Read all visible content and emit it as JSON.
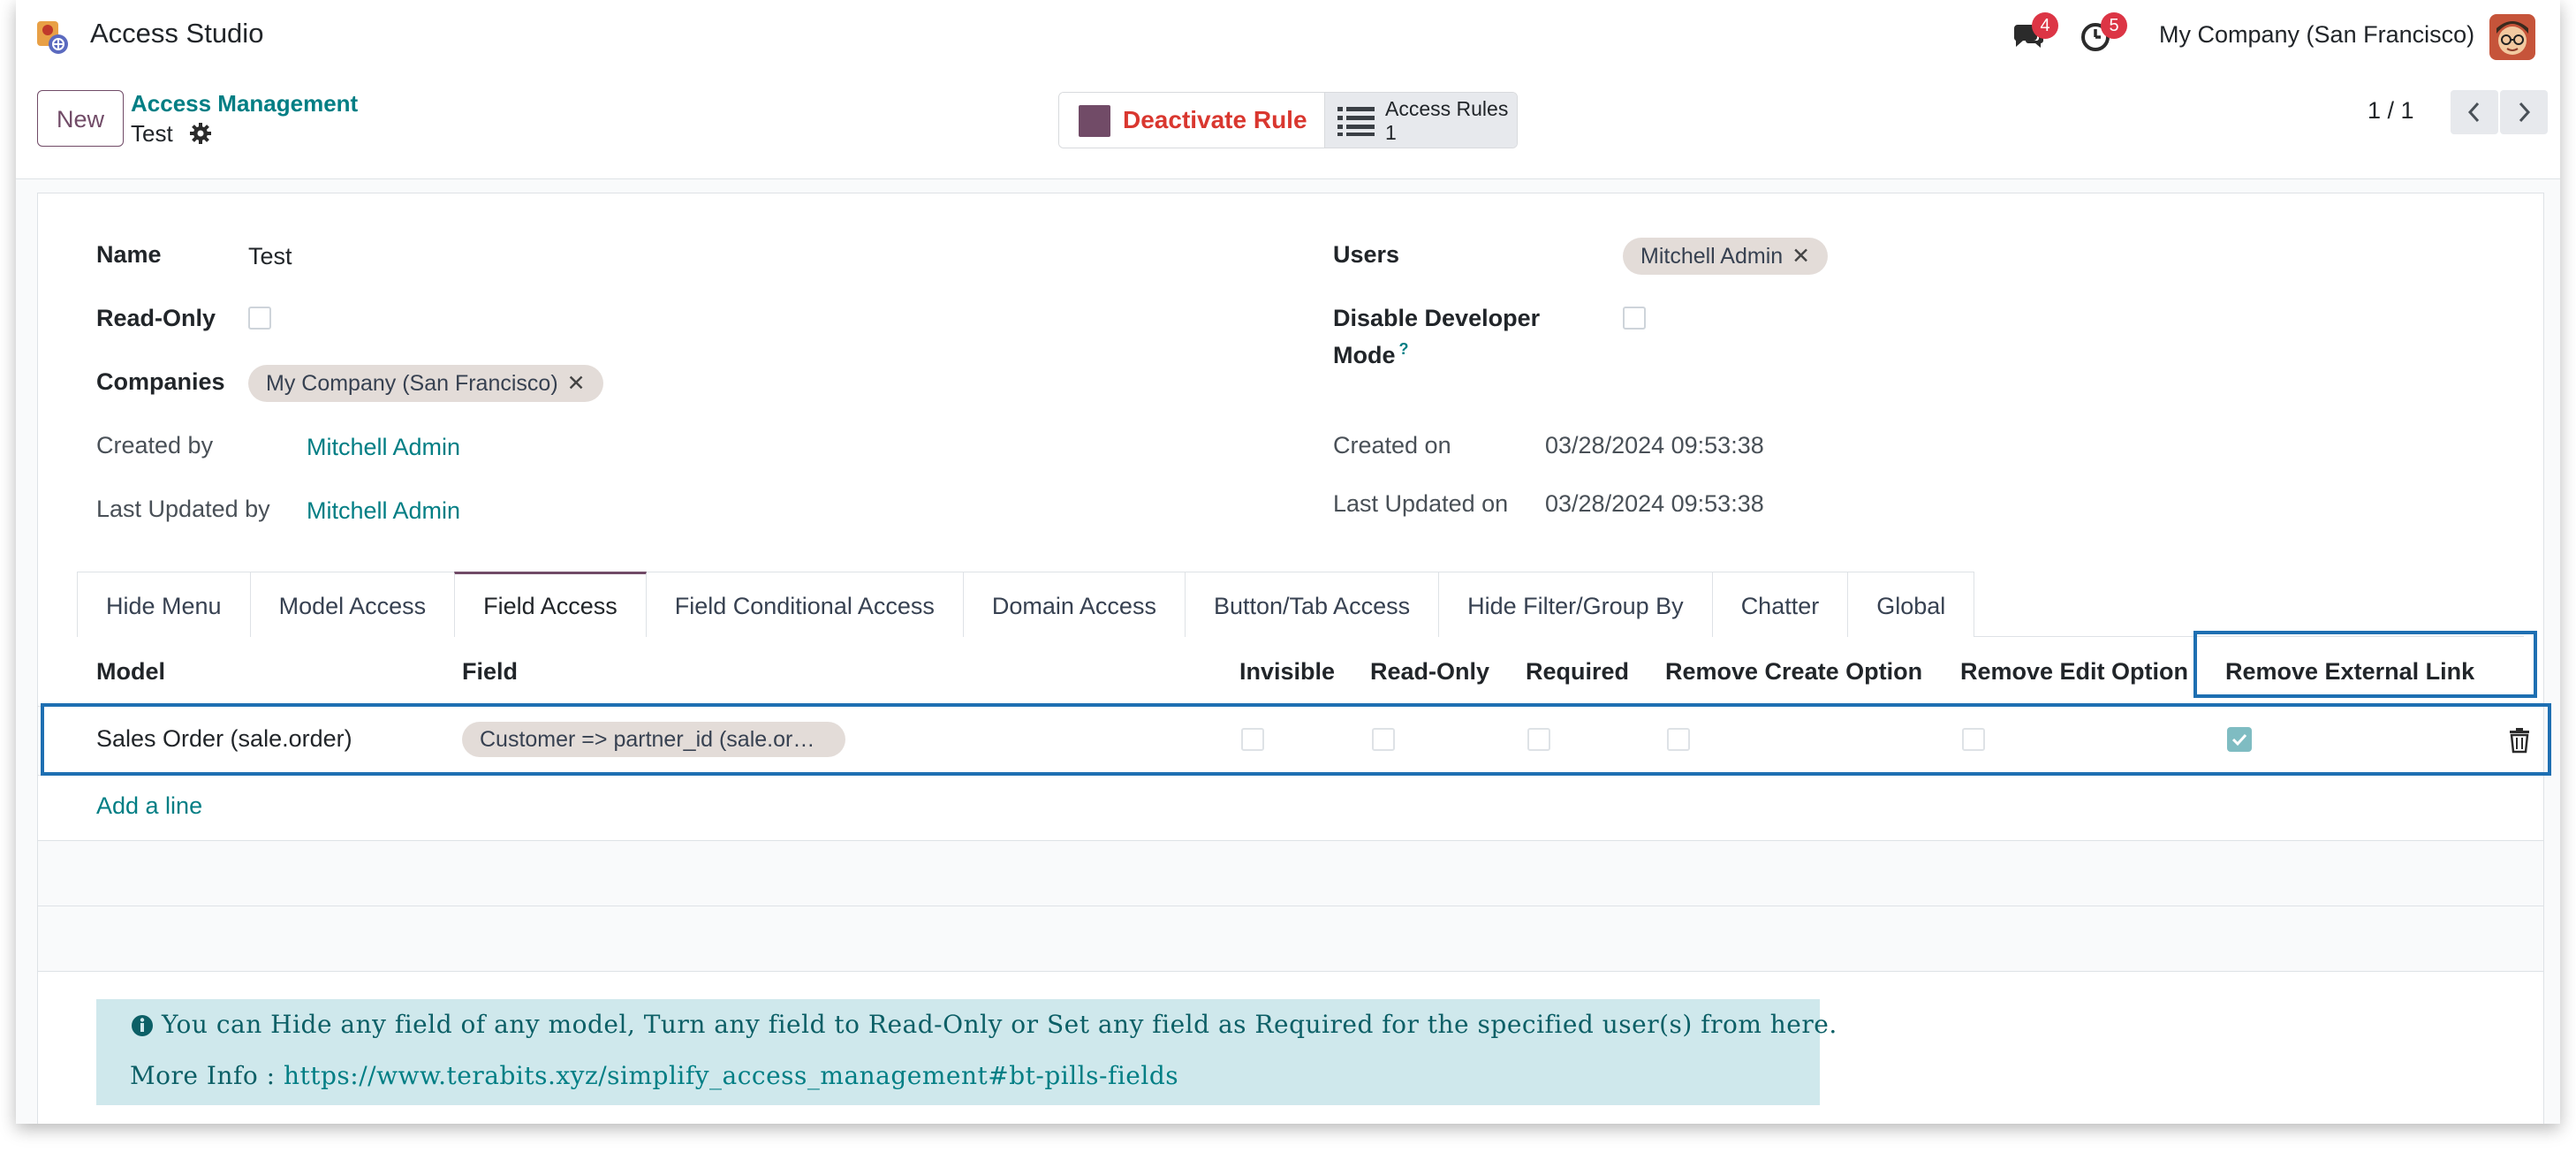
{
  "navbar": {
    "app_title": "Access Studio",
    "messages_badge": "4",
    "activity_badge": "5",
    "company": "My Company (San Francisco)"
  },
  "control_panel": {
    "new_label": "New",
    "breadcrumb_parent": "Access Management",
    "breadcrumb_current": "Test",
    "deactivate_label": "Deactivate Rule",
    "access_rules_label": "Access Rules",
    "access_rules_count": "1",
    "pager": "1 / 1"
  },
  "form": {
    "name_label": "Name",
    "name_value": "Test",
    "readonly_label": "Read-Only",
    "companies_label": "Companies",
    "company_tag": "My Company (San Francisco)",
    "created_by_label": "Created by",
    "created_by_value": "Mitchell Admin",
    "last_updated_by_label": "Last Updated by",
    "last_updated_by_value": "Mitchell Admin",
    "users_label": "Users",
    "user_tag": "Mitchell Admin",
    "disable_dev_label_1": "Disable Developer",
    "disable_dev_label_2": "Mode",
    "help_mark": "?",
    "created_on_label": "Created on",
    "created_on_value": "03/28/2024 09:53:38",
    "last_updated_on_label": "Last Updated on",
    "last_updated_on_value": "03/28/2024 09:53:38"
  },
  "tabs": [
    {
      "label": "Hide Menu",
      "active": false
    },
    {
      "label": "Model Access",
      "active": false
    },
    {
      "label": "Field Access",
      "active": true
    },
    {
      "label": "Field Conditional Access",
      "active": false
    },
    {
      "label": "Domain Access",
      "active": false
    },
    {
      "label": "Button/Tab Access",
      "active": false
    },
    {
      "label": "Hide Filter/Group By",
      "active": false
    },
    {
      "label": "Chatter",
      "active": false
    },
    {
      "label": "Global",
      "active": false
    }
  ],
  "table": {
    "headers": {
      "model": "Model",
      "field": "Field",
      "invisible": "Invisible",
      "readonly": "Read-Only",
      "required": "Required",
      "remove_create": "Remove Create Option",
      "remove_edit": "Remove Edit Option",
      "remove_external": "Remove External Link"
    },
    "rows": [
      {
        "model": "Sales Order (sale.order)",
        "field": "Customer => partner_id (sale.or…",
        "invisible": false,
        "readonly": false,
        "required": false,
        "remove_create": false,
        "remove_edit": false,
        "remove_external": true
      }
    ],
    "add_line": "Add a line"
  },
  "info": {
    "line1": "You can Hide any field of any model, Turn any field to Read-Only or Set any field as Required for the specified user(s) from here.",
    "more_prefix": "More Info : ",
    "more_link": "https://www.terabits.xyz/simplify_access_management#bt-pills-fields"
  },
  "colors": {
    "brand": "#714b67",
    "link": "#017e84",
    "highlight": "#1e6fb2",
    "danger": "#d9372f"
  }
}
